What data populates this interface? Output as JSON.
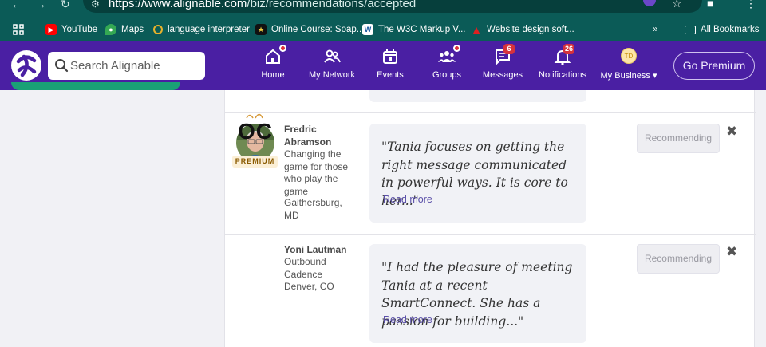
{
  "browser": {
    "url_host": "https://www.alignable.com",
    "url_path": "/biz/recommendations/accepted",
    "bookmarks": [
      {
        "label": "YouTube"
      },
      {
        "label": "Maps"
      },
      {
        "label": "language interpreter"
      },
      {
        "label": "Online Course: Soap..."
      },
      {
        "label": "The W3C Markup V..."
      },
      {
        "label": "Website design soft..."
      }
    ],
    "all_bookmarks": "All Bookmarks"
  },
  "header": {
    "search_placeholder": "Search Alignable",
    "nav": [
      {
        "label": "Home",
        "badge": ""
      },
      {
        "label": "My Network",
        "badge": ""
      },
      {
        "label": "Events",
        "badge": ""
      },
      {
        "label": "Groups",
        "badge": ""
      },
      {
        "label": "Messages",
        "badge": "6"
      },
      {
        "label": "Notifications",
        "badge": "26"
      },
      {
        "label": "My Business",
        "badge": ""
      }
    ],
    "avatar_initials": "TD",
    "premium_label": "Go Premium"
  },
  "recommendations": [
    {
      "name": "Fredric Abramson",
      "tag": "PREMIUM",
      "description": "Changing the game for those who play the game",
      "location": "Gaithersburg, MD",
      "quote": "\"Tania focuses on getting the right message communicated in powerful ways. It is core to her...\"",
      "read_more": "Read more",
      "action": "Recommending"
    },
    {
      "name": "Yoni Lautman",
      "logo_text": "OC",
      "description": "Outbound Cadence",
      "location": "Denver, CO",
      "quote": "\"I had the pleasure of meeting Tania at a recent SmartConnect. She has a passion for building...\"",
      "read_more": "Read more",
      "action": "Recommending"
    }
  ],
  "colors": {
    "brand_purple": "#4a1fa3",
    "chrome_teal": "#0b5b57",
    "badge_red": "#d6323c"
  }
}
